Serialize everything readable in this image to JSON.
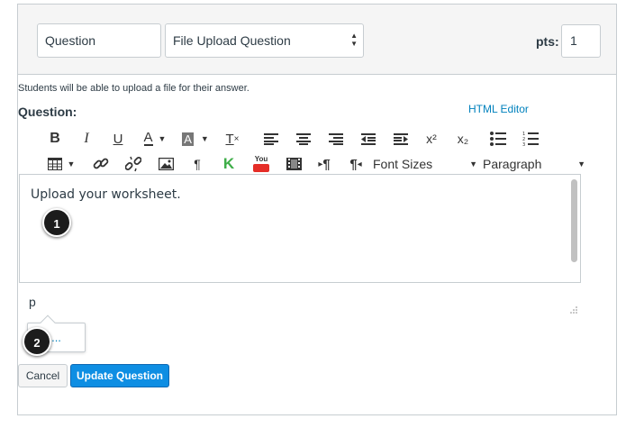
{
  "question": {
    "name_value": "Question",
    "type_value": "File Upload Question",
    "pts_label": "pts:",
    "pts_value": "1"
  },
  "form": {
    "hint": "Students will be able to upload a file for their answer.",
    "question_label": "Question:",
    "html_editor_link": "HTML Editor"
  },
  "toolbar": {
    "row1": [
      "bold-icon",
      "italic-icon",
      "underline-icon",
      "text-color-icon",
      "background-color-icon",
      "clear-formatting-icon",
      "align-left-icon",
      "align-center-icon",
      "align-right-icon",
      "outdent-icon",
      "indent-icon",
      "superscript-icon",
      "subscript-icon",
      "bullet-list-icon",
      "numbered-list-icon"
    ],
    "row2": [
      "table-icon",
      "link-icon",
      "unlink-icon",
      "image-icon",
      "paragraph-mark-icon",
      "kaltura-icon",
      "youtube-icon",
      "media-icon",
      "ltr-icon",
      "rtl-icon"
    ],
    "font_sizes": "Font Sizes",
    "paragraph": "Paragraph",
    "bold_glyph": "B",
    "italic_glyph": "I",
    "underline_glyph": "U",
    "text_color_glyph": "A",
    "bg_color_glyph": "A",
    "clear_glyph": "T",
    "superscript_glyph": "x²",
    "subscript_glyph": "x₂",
    "paragraph_glyph": "¶",
    "kaltura_glyph": "K",
    "youtube_glyph": "You",
    "ltr_glyph": "¶",
    "rtl_glyph": "¶"
  },
  "editor": {
    "content": "Upload your worksheet.",
    "path": "p",
    "popup_text": "..."
  },
  "badges": {
    "one": "1",
    "two": "2"
  },
  "buttons": {
    "cancel": "Cancel",
    "update": "Update Question"
  },
  "colors": {
    "link": "#0081bd",
    "primary": "#0e8ee3",
    "border": "#c7cdd1",
    "youtube_red": "#e52d27",
    "kaltura_green": "#3fae49"
  }
}
